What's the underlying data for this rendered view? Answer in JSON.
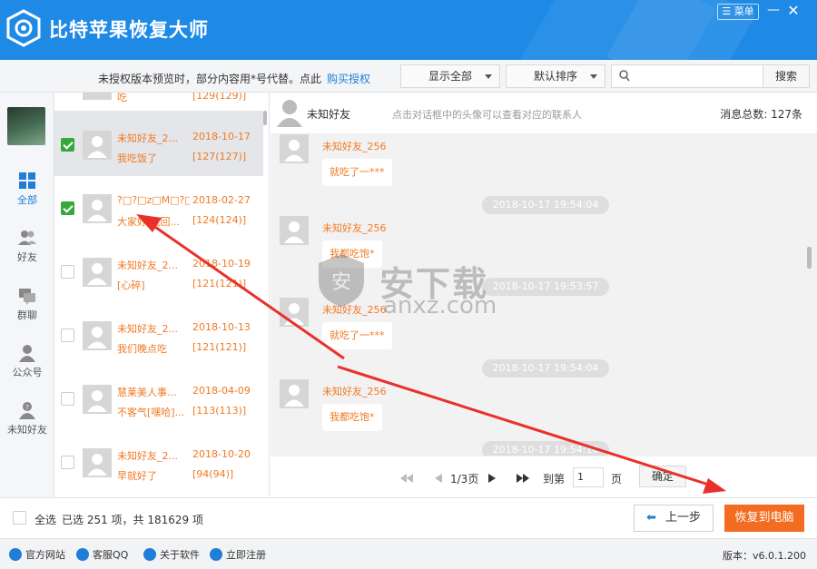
{
  "app": {
    "title": "比特苹果恢复大师",
    "menu_label": "菜单",
    "minimize": "—",
    "close": "✕"
  },
  "toolbar": {
    "notice": "未授权版本预览时，部分内容用*号代替。点此",
    "buy_link": "购买授权",
    "filter_select": "显示全部",
    "sort_select": "默认排序",
    "search_placeholder": "",
    "search_button": "搜索"
  },
  "sidebar": {
    "items": [
      {
        "label": "全部",
        "icon": "grid-icon"
      },
      {
        "label": "好友",
        "icon": "friends-icon"
      },
      {
        "label": "群聊",
        "icon": "group-chat-icon"
      },
      {
        "label": "公众号",
        "icon": "official-account-icon"
      },
      {
        "label": "未知好友",
        "icon": "unknown-friend-icon"
      }
    ]
  },
  "contacts": [
    {
      "name": "未知好友_2...",
      "date": "2018-10-17",
      "last_msg": "我吃饭了",
      "count": "[127(127)]",
      "checked": true,
      "selected": true
    },
    {
      "name": "?□?□z□M□?□...",
      "date": "2018-02-27",
      "last_msg": "大家好,我回...",
      "count": "[124(124)]",
      "checked": true,
      "selected": false
    },
    {
      "name": "未知好友_2...",
      "date": "2018-10-19",
      "last_msg": "[心碎]",
      "count": "[121(121)]",
      "checked": false,
      "selected": false
    },
    {
      "name": "未知好友_2...",
      "date": "2018-10-13",
      "last_msg": "我们晚点吃",
      "count": "[121(121)]",
      "checked": false,
      "selected": false
    },
    {
      "name": "慧莱美人事...",
      "date": "2018-04-09",
      "last_msg": "不客气[嘿哈]...",
      "count": "[113(113)]",
      "checked": false,
      "selected": false
    },
    {
      "name": "未知好友_2...",
      "date": "2018-10-20",
      "last_msg": "早就好了",
      "count": "[94(94)]",
      "checked": false,
      "selected": false
    }
  ],
  "contacts_partial_top": {
    "name": "吃",
    "count": "[129(129)]"
  },
  "chat": {
    "header_name": "未知好友",
    "header_hint": "点击对话框中的头像可以查看对应的联系人",
    "total_label": "消息总数: 127条",
    "messages": [
      {
        "type": "msg",
        "sender": "未知好友_256",
        "text": "就吃了一***"
      },
      {
        "type": "time",
        "text": "2018-10-17 19:54:04"
      },
      {
        "type": "msg",
        "sender": "未知好友_256",
        "text": "我都吃饱*"
      },
      {
        "type": "time",
        "text": "2018-10-17 19:53:57"
      },
      {
        "type": "msg",
        "sender": "未知好友_256",
        "text": "就吃了一***"
      },
      {
        "type": "time",
        "text": "2018-10-17 19:54:04"
      },
      {
        "type": "msg",
        "sender": "未知好友_256",
        "text": "我都吃饱*"
      },
      {
        "type": "time",
        "text": "2018-10-17 19:54:16"
      }
    ]
  },
  "pager": {
    "page_text": "1/3页",
    "goto_label": "到第",
    "page_input": "1",
    "page_unit": "页",
    "confirm": "确定"
  },
  "bottom": {
    "select_all": "全选",
    "selection_info": "已选 251 项，共 181629 项",
    "prev_button": "上一步",
    "recover_button": "恢复到电脑"
  },
  "footer": {
    "links": [
      "官方网站",
      "客服QQ",
      "关于软件",
      "立即注册"
    ],
    "version": "版本：v6.0.1.200"
  },
  "watermark": {
    "text": "安下载",
    "sub": "anxz.com"
  },
  "colors": {
    "brand_blue": "#1e8ae6",
    "accent_orange": "#f26d21",
    "check_green": "#35a93d",
    "arrow_red": "#e8312a"
  }
}
